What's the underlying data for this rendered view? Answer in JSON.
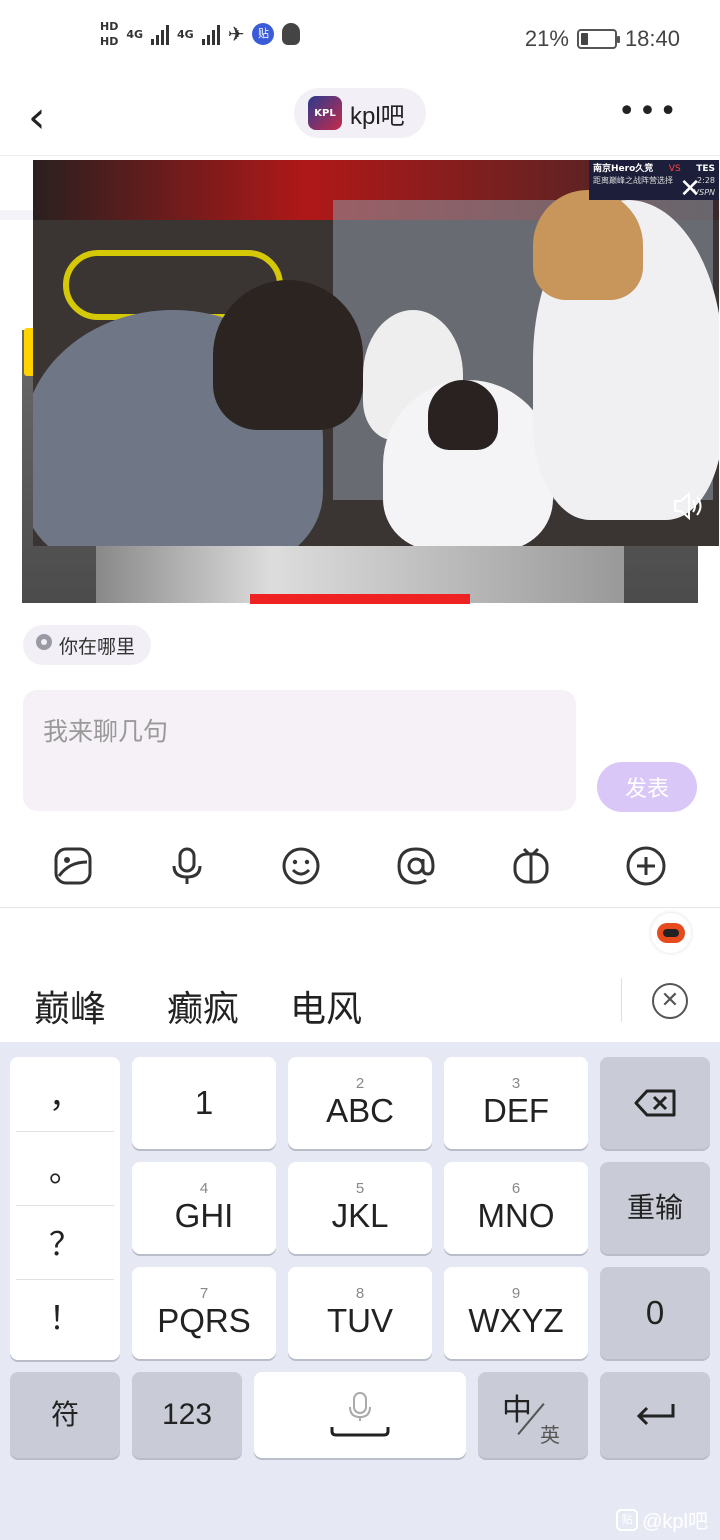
{
  "status_bar": {
    "hd1": "HD",
    "hd2": "HD",
    "net1": "4G",
    "net2": "4G",
    "battery_pct_text": "21%",
    "battery_level": 0.21,
    "time": "18:40",
    "app_badge": "贴"
  },
  "header": {
    "back_icon": "chevron-left-icon",
    "forum_name": "kpl吧",
    "forum_logo_text": "KPL",
    "more_icon": "more-dots-icon"
  },
  "video": {
    "team_left": "南京Hero久竞",
    "vs": "VS",
    "team_right": "TES",
    "subtitle": "距离巅峰之战阵营选择",
    "timer": "2:28",
    "broadcaster": "VSPN"
  },
  "location_chip": {
    "label": "你在哪里"
  },
  "composer": {
    "placeholder": "我来聊几句",
    "publish_label": "发表"
  },
  "toolbar": {
    "icons": [
      "image-icon",
      "microphone-icon",
      "emoji-icon",
      "mention-at-icon",
      "tv-icon",
      "add-icon"
    ]
  },
  "candidates": {
    "words": [
      "巅峰",
      "癫疯",
      "电风"
    ]
  },
  "keyboard": {
    "punctuation": [
      "，",
      "。",
      "？",
      "！"
    ],
    "keys": [
      {
        "num": "",
        "label": "1"
      },
      {
        "num": "2",
        "label": "ABC"
      },
      {
        "num": "3",
        "label": "DEF"
      },
      {
        "num": "4",
        "label": "GHI"
      },
      {
        "num": "5",
        "label": "JKL"
      },
      {
        "num": "6",
        "label": "MNO"
      },
      {
        "num": "7",
        "label": "PQRS"
      },
      {
        "num": "8",
        "label": "TUV"
      },
      {
        "num": "9",
        "label": "WXYZ"
      }
    ],
    "reenter_label": "重输",
    "zero_label": "0",
    "symbol_label": "符",
    "numeric_label": "123",
    "lang_main": "中",
    "lang_alt": "英"
  },
  "watermark": {
    "text": "@kpl吧",
    "box": "贴"
  }
}
